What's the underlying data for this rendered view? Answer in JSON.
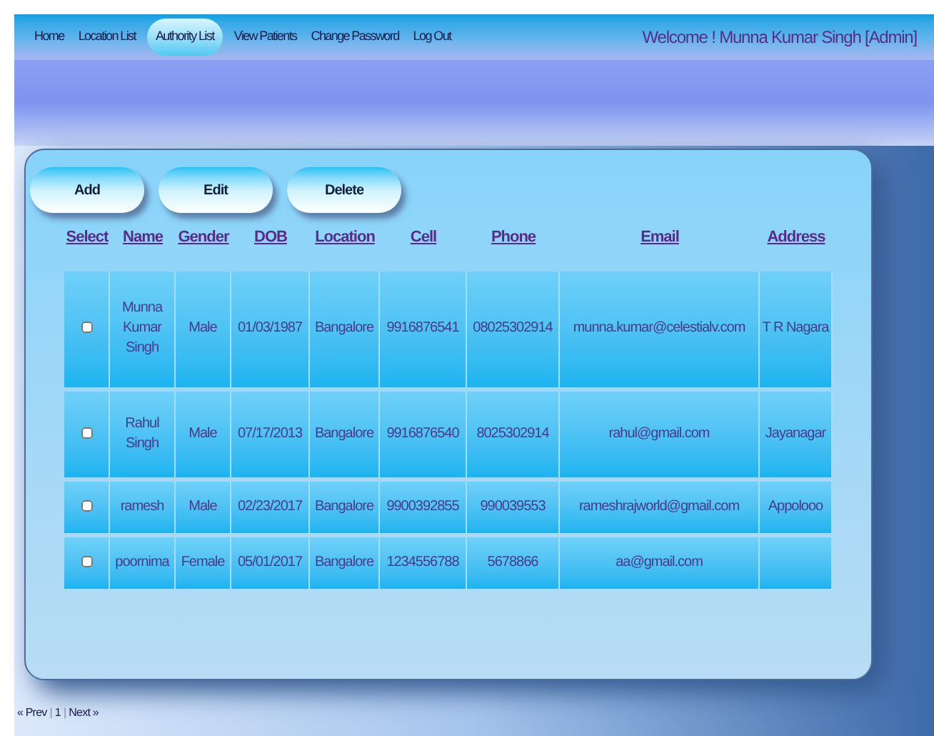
{
  "nav": [
    {
      "label": "Home",
      "selected": false
    },
    {
      "label": "Location List",
      "selected": false
    },
    {
      "label": "Authority List",
      "selected": true
    },
    {
      "label": "View Patients",
      "selected": false
    },
    {
      "label": "Change Password",
      "selected": false
    },
    {
      "label": "Log Out",
      "selected": false
    }
  ],
  "welcome": "Welcome ! Munna Kumar Singh [Admin]",
  "buttons": [
    "Add",
    "Edit",
    "Delete"
  ],
  "table": {
    "columns": [
      "Select",
      "Name",
      "Gender",
      "DOB",
      "Location",
      "Cell",
      "Phone",
      "Email",
      "Address"
    ],
    "rows": [
      {
        "cells": [
          {
            "kind": "checkbox",
            "checked": false
          },
          "Munna Kumar Singh",
          "Male",
          "01/03/1987",
          "Bangalore",
          "9916876541",
          "08025302914",
          "munna.kumar@celestialv.com",
          "T R Nagara"
        ]
      },
      {
        "cells": [
          {
            "kind": "checkbox",
            "checked": false
          },
          "Rahul Singh",
          "Male",
          "07/17/2013",
          "Bangalore",
          "9916876540",
          "8025302914",
          "rahul@gmail.com",
          "Jayanagar"
        ]
      },
      {
        "cells": [
          {
            "kind": "checkbox",
            "checked": false
          },
          "ramesh",
          "Male",
          "02/23/2017",
          "Bangalore",
          "9900392855",
          "990039553",
          "rameshrajworld@gmail.com",
          "Appolooo"
        ]
      },
      {
        "cells": [
          {
            "kind": "checkbox",
            "checked": false
          },
          "poornima",
          "Female",
          "05/01/2017",
          "Bangalore",
          "1234556788",
          "5678866",
          "aa@gmail.com",
          ""
        ]
      }
    ]
  },
  "pager": [
    {
      "kind": "link",
      "text": "« Prev"
    },
    {
      "kind": "sep",
      "text": "|"
    },
    {
      "kind": "link",
      "text": "1"
    },
    {
      "kind": "sep",
      "text": "|"
    },
    {
      "kind": "link",
      "text": "Next »"
    }
  ]
}
